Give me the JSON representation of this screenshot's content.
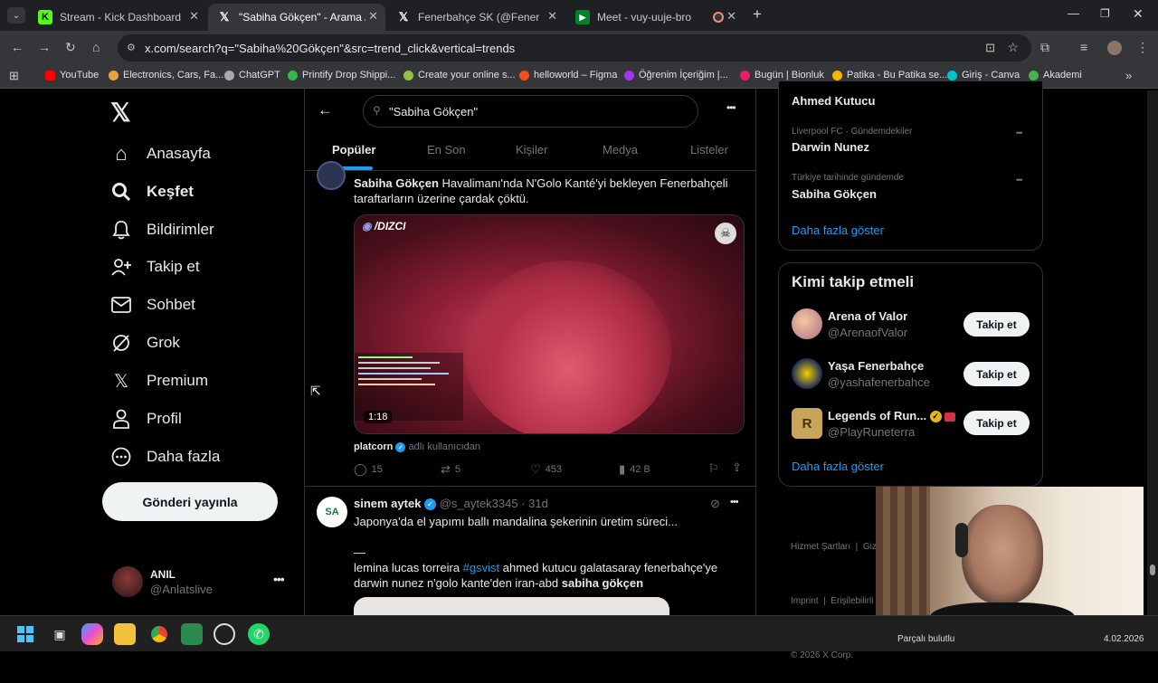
{
  "browser": {
    "tabs": [
      {
        "title": "Stream - Kick Dashboard",
        "active": false
      },
      {
        "title": "\"Sabiha Gökçen\" - Arama / X",
        "active": true
      },
      {
        "title": "Fenerbahçe SK (@Fenerbahçe)",
        "active": false
      },
      {
        "title": "Meet - vuy-uuje-bro",
        "active": false
      }
    ],
    "url": "x.com/search?q=\"Sabiha%20Gökçen\"&src=trend_click&vertical=trends",
    "bookmarks": [
      "YouTube",
      "Electronics, Cars, Fa...",
      "ChatGPT",
      "Printify Drop Shippi...",
      "Create your online s...",
      "helloworld – Figma",
      "Öğrenim İçeriğim |...",
      "Bugün | Bionluk",
      "Patika - Bu Patika se...",
      "Giriş - Canva",
      "Akademi"
    ]
  },
  "nav": {
    "items": [
      "Anasayfa",
      "Keşfet",
      "Bildirimler",
      "Takip et",
      "Sohbet",
      "Grok",
      "Premium",
      "Profil",
      "Daha fazla"
    ],
    "post_button": "Gönderi yayınla",
    "account_name": "ANIL",
    "account_handle": "@Anlatslive"
  },
  "search": {
    "query": "\"Sabiha Gökçen\"",
    "tabs": [
      "Popüler",
      "En Son",
      "Kişiler",
      "Medya",
      "Listeler"
    ]
  },
  "tweet1": {
    "text_bold": "Sabiha Gökçen",
    "text_line1_rest": " Havalimanı'nda N'Golo Kanté'yi bekleyen Fenerbahçeli",
    "text_line2": "taraftarların üzerine çardak çöktü.",
    "video_logo": "/DIZCI",
    "video_duration": "1:18",
    "source_user": "platcorn",
    "source_suffix": "adlı kullanıcıdan",
    "replies": "15",
    "retweets": "5",
    "likes": "453",
    "views": "42 B"
  },
  "tweet2": {
    "avatar_text": "SA",
    "name": "sinem aytek",
    "handle": "@s_aytek3345",
    "time": "· 31d",
    "line1": "Japonya'da el yapımı ballı mandalina şekerinin üretim süreci...",
    "dash": "—",
    "line2_pre": "lemina lucas torreira ",
    "hashtag": "#gsvist",
    "line2_post": " ahmed kutucu galatasaray fenerbahçe'ye",
    "line3_pre": "darwin nunez n'golo kante'den iran-abd ",
    "line3_bold": "sabiha gökçen"
  },
  "trends": {
    "top_name": "Ahmed Kutucu",
    "items": [
      {
        "category": "Liverpool FC · Gündemdekiler",
        "name": "Darwin Nunez"
      },
      {
        "category": "Türkiye tarihinde gündemde",
        "name": "Sabiha Gökçen"
      }
    ],
    "show_more": "Daha fazla göster"
  },
  "who_to_follow": {
    "title": "Kimi takip etmeli",
    "accounts": [
      {
        "name": "Arena of Valor",
        "handle": "@ArenaofValor"
      },
      {
        "name": "Yaşa Fenerbahçe",
        "handle": "@yashafenerbahce"
      },
      {
        "name": "Legends of Run...",
        "handle": "@PlayRuneterra"
      }
    ],
    "follow_label": "Takip et",
    "show_more": "Daha fazla göster"
  },
  "footer": {
    "l1": "Hizmet Şartları  |  Giz",
    "l2": "Imprint  |  Erişilebilirli",
    "l3": "© 2026 X Corp."
  },
  "taskbar": {
    "notification": "Parçalı bulutlu",
    "date": "4.02.2026"
  },
  "colors": {
    "accent": "#1d9bf0",
    "background": "#000000",
    "border": "#2f3336"
  }
}
